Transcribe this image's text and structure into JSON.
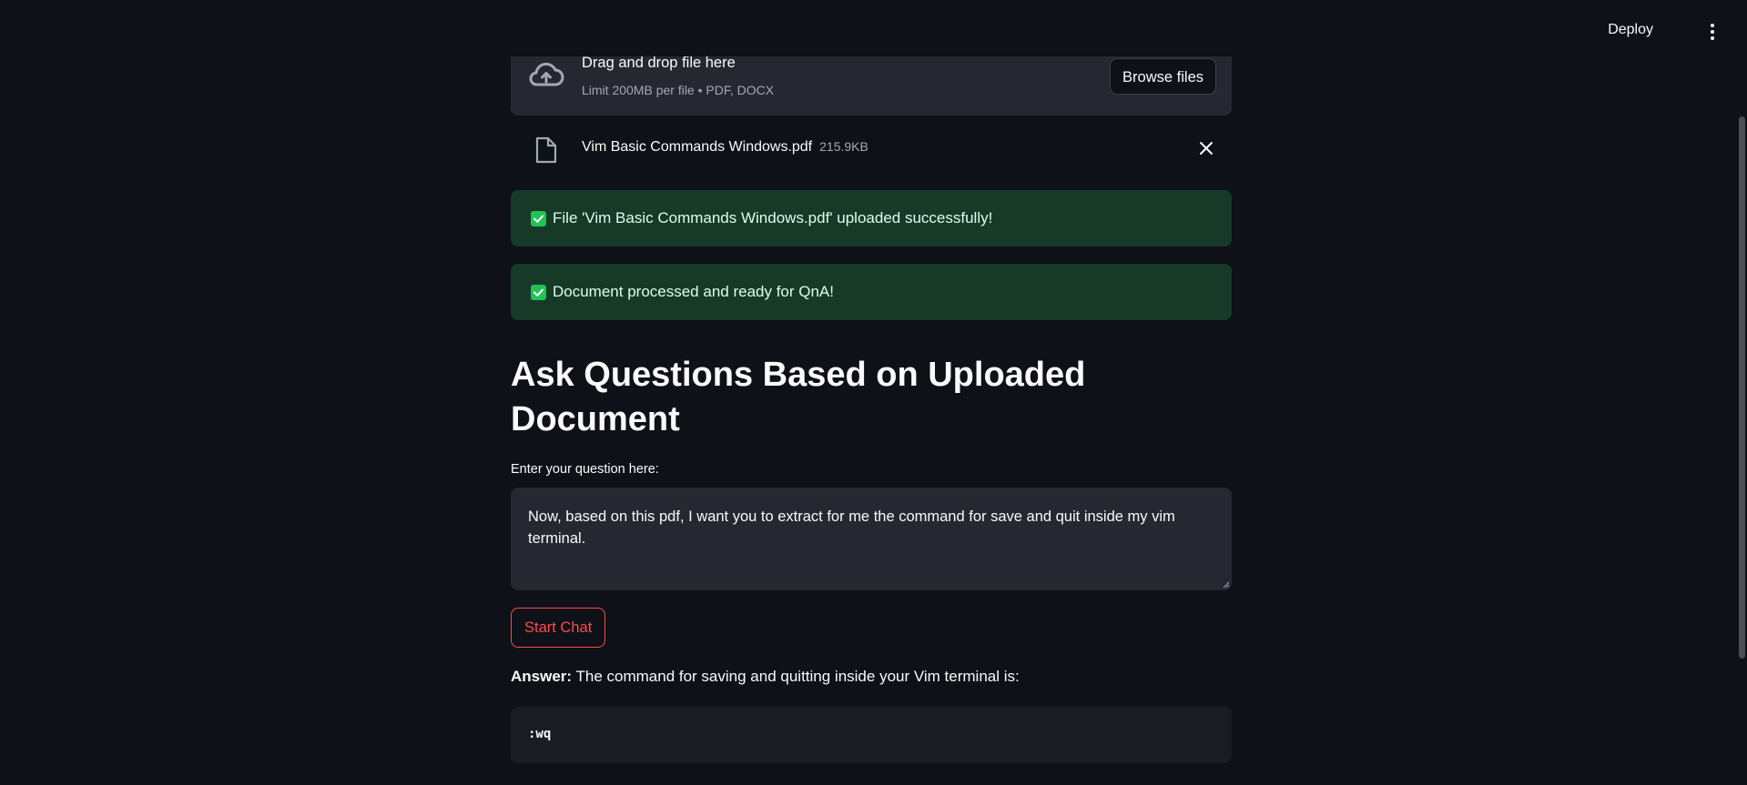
{
  "header": {
    "deploy_label": "Deploy",
    "menu_icon": "kebab-menu-icon"
  },
  "uploader": {
    "title": "Drag and drop file here",
    "subtitle": "Limit 200MB per file • PDF, DOCX",
    "browse_label": "Browse files",
    "icon": "cloud-upload-icon"
  },
  "uploaded_file": {
    "name": "Vim Basic Commands Windows.pdf",
    "size": "215.9KB",
    "icon": "file-icon",
    "remove_icon": "close-icon"
  },
  "alerts": [
    {
      "message": "File 'Vim Basic Commands Windows.pdf' uploaded successfully!",
      "icon": "checkbox-icon"
    },
    {
      "message": "Document processed and ready for QnA!",
      "icon": "checkbox-icon"
    }
  ],
  "qa": {
    "heading": "Ask Questions Based on Uploaded Document",
    "input_label": "Enter your question here:",
    "question": "Now, based on this pdf, I want you to extract for me the command for save and quit inside my vim terminal.",
    "button_label": "Start Chat",
    "answer_label": "Answer:",
    "answer_text": " The command for saving and quitting inside your Vim terminal is:",
    "code": ":wq"
  },
  "colors": {
    "background": "#0e1117",
    "accent": "#ff4b4b",
    "success_bg": "#173928",
    "success_icon": "#21c354"
  }
}
